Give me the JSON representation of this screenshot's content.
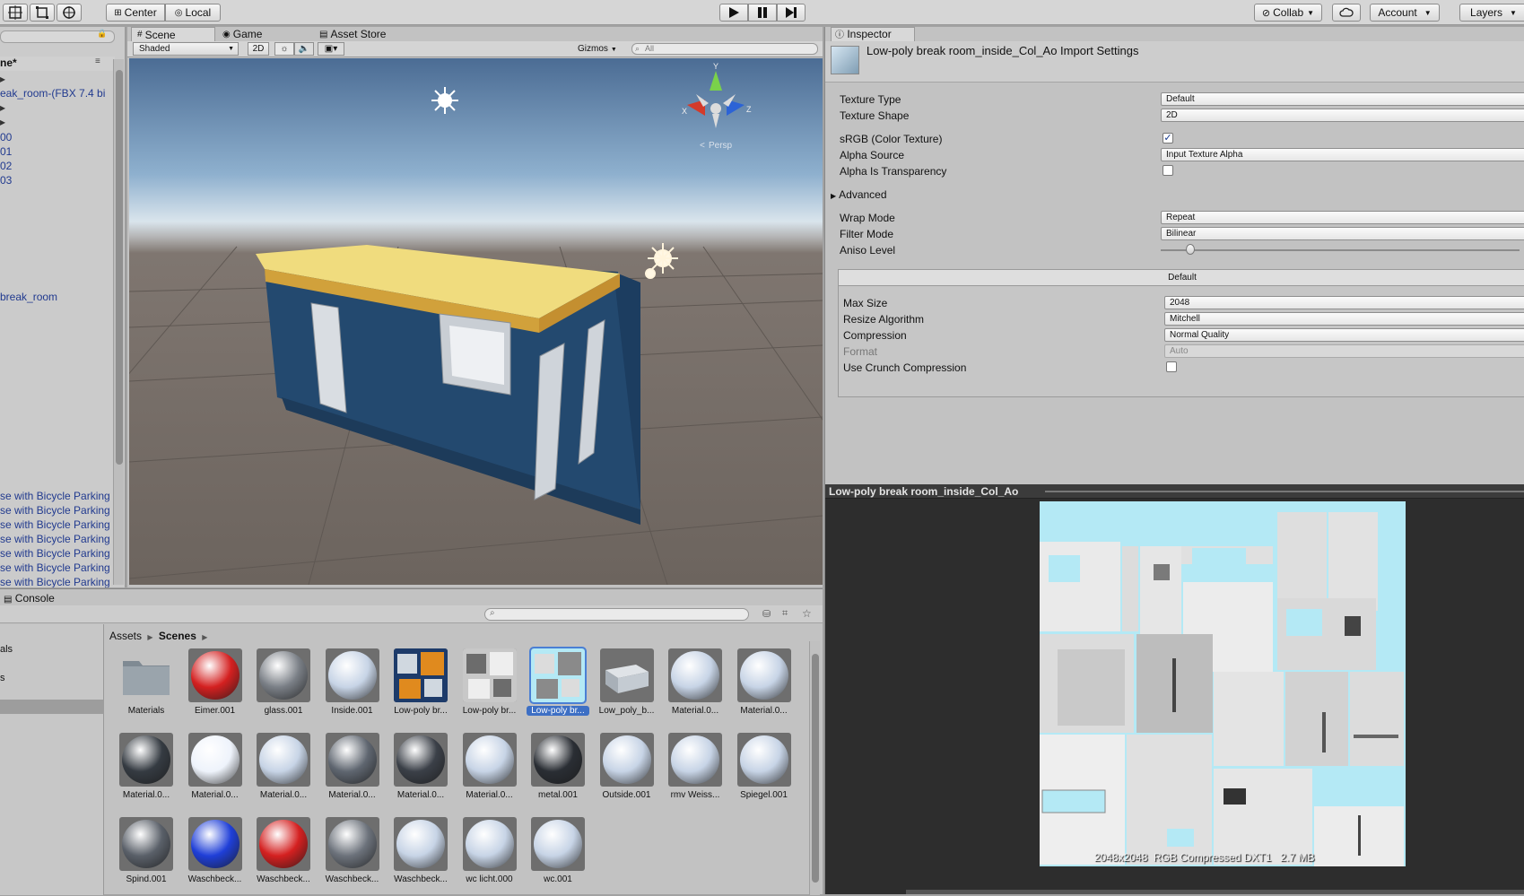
{
  "toolbar": {
    "center_label": "Center",
    "local_label": "Local",
    "collab_label": "Collab",
    "account_label": "Account",
    "layers_label": "Layers"
  },
  "hierarchy": {
    "scene_title": "ne*",
    "rows": [
      "eak_room-(FBX 7.4 bi",
      "00",
      "01",
      "02",
      "03",
      "break_room",
      "se with Bicycle Parking",
      "se with Bicycle Parking",
      "se with Bicycle Parking",
      "se with Bicycle Parking",
      "se with Bicycle Parking",
      "se with Bicycle Parking",
      "se with Bicycle Parking"
    ]
  },
  "scene_panel": {
    "tabs": [
      "Scene",
      "Game",
      "Asset Store"
    ],
    "shading_mode": "Shaded",
    "mode_2d": "2D",
    "gizmos_label": "Gizmos",
    "search_placeholder": "All",
    "persp_label": "Persp",
    "axis_labels": {
      "y": "Y",
      "x": "X",
      "z": "Z"
    }
  },
  "inspector": {
    "tab_label": "Inspector",
    "title": "Low-poly break room_inside_Col_Ao Import Settings",
    "texture_type_label": "Texture Type",
    "texture_type": "Default",
    "texture_shape_label": "Texture Shape",
    "texture_shape": "2D",
    "srgb_label": "sRGB (Color Texture)",
    "srgb_checked": true,
    "alpha_source_label": "Alpha Source",
    "alpha_source": "Input Texture Alpha",
    "alpha_transparency_label": "Alpha Is Transparency",
    "alpha_transparency_checked": false,
    "advanced_label": "Advanced",
    "wrap_mode_label": "Wrap Mode",
    "wrap_mode": "Repeat",
    "filter_mode_label": "Filter Mode",
    "filter_mode": "Bilinear",
    "aniso_level_label": "Aniso Level",
    "aniso_level_fraction": 0.07,
    "platform_tab": "Default",
    "max_size_label": "Max Size",
    "max_size": "2048",
    "resize_label": "Resize Algorithm",
    "resize": "Mitchell",
    "compression_label": "Compression",
    "compression": "Normal Quality",
    "format_label": "Format",
    "format": "Auto",
    "crunch_label": "Use Crunch Compression",
    "crunch_checked": false
  },
  "preview": {
    "title": "Low-poly break room_inside_Col_Ao",
    "info": "2048x2048  RGB Compressed DXT1   2.7 MB"
  },
  "project": {
    "console_tab": "Console",
    "left_items": [
      "als",
      "s"
    ],
    "breadcrumb": [
      "Assets",
      "Scenes"
    ],
    "assets": [
      {
        "name": "Materials",
        "kind": "folder"
      },
      {
        "name": "Eimer.001",
        "kind": "sphere",
        "color": "#d42020"
      },
      {
        "name": "glass.001",
        "kind": "sphere",
        "color": "#7a7f86"
      },
      {
        "name": "Inside.001",
        "kind": "sphere",
        "color": "#c7d4e6"
      },
      {
        "name": "Low-poly br...",
        "kind": "texture-blue"
      },
      {
        "name": "Low-poly br...",
        "kind": "texture-gray"
      },
      {
        "name": "Low-poly br...",
        "kind": "texture-selected"
      },
      {
        "name": "Low_poly_b...",
        "kind": "model"
      },
      {
        "name": "Material.0...",
        "kind": "sphere",
        "color": "#c7d4e6"
      },
      {
        "name": "Material.0...",
        "kind": "sphere",
        "color": "#c7d4e6"
      },
      {
        "name": "Material.0...",
        "kind": "sphere",
        "color": "#353b42"
      },
      {
        "name": "Material.0...",
        "kind": "sphere",
        "color": "#eef3fb"
      },
      {
        "name": "Material.0...",
        "kind": "sphere",
        "color": "#c7d4e6"
      },
      {
        "name": "Material.0...",
        "kind": "sphere",
        "color": "#5f6670"
      },
      {
        "name": "Material.0...",
        "kind": "sphere",
        "color": "#3b4048"
      },
      {
        "name": "Material.0...",
        "kind": "sphere",
        "color": "#c7d4e6"
      },
      {
        "name": "metal.001",
        "kind": "sphere",
        "color": "#2a2e34"
      },
      {
        "name": "Outside.001",
        "kind": "sphere",
        "color": "#c7d4e6"
      },
      {
        "name": "rmv Weiss...",
        "kind": "sphere",
        "color": "#c7d4e6"
      },
      {
        "name": "Spiegel.001",
        "kind": "sphere",
        "color": "#c7d4e6"
      },
      {
        "name": "Spind.001",
        "kind": "sphere",
        "color": "#5a6069"
      },
      {
        "name": "Waschbeck...",
        "kind": "sphere",
        "color": "#1f3fd8"
      },
      {
        "name": "Waschbeck...",
        "kind": "sphere",
        "color": "#d42020"
      },
      {
        "name": "Waschbeck...",
        "kind": "sphere",
        "color": "#6c727b"
      },
      {
        "name": "Waschbeck...",
        "kind": "sphere",
        "color": "#c7d4e6"
      },
      {
        "name": "wc licht.000",
        "kind": "sphere",
        "color": "#c7d4e6"
      },
      {
        "name": "wc.001",
        "kind": "sphere",
        "color": "#c7d4e6"
      }
    ]
  }
}
